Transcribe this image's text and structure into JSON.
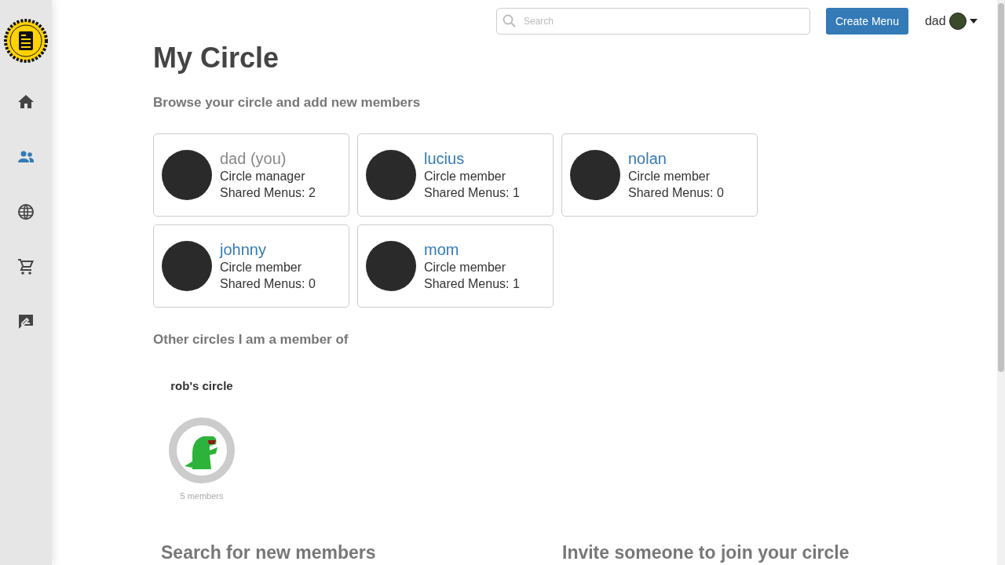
{
  "sidebar": {
    "items": [
      {
        "kind": "home",
        "selected": false
      },
      {
        "kind": "people",
        "selected": true
      },
      {
        "kind": "globe",
        "selected": false
      },
      {
        "kind": "cart",
        "selected": false
      },
      {
        "kind": "feedback",
        "selected": false
      }
    ]
  },
  "top_bar": {
    "search": {
      "placeholder": "Search"
    },
    "create_button": "Create Menu",
    "user": "dad"
  },
  "title": "My Circle",
  "subtitle": "Browse your circle and add new members",
  "members": [
    {
      "name": "dad (you)",
      "self": true,
      "role": "Circle manager",
      "shared": "Shared Menus: 2"
    },
    {
      "name": "lucius",
      "self": false,
      "role": "Circle member",
      "shared": "Shared Menus: 1"
    },
    {
      "name": "nolan",
      "self": false,
      "role": "Circle member",
      "shared": "Shared Menus: 0"
    },
    {
      "name": "johnny",
      "self": false,
      "role": "Circle member",
      "shared": "Shared Menus: 0"
    },
    {
      "name": "mom",
      "self": false,
      "role": "Circle member",
      "shared": "Shared Menus: 1"
    }
  ],
  "other_circles": {
    "heading": "Other circles I am a member of",
    "circles": [
      {
        "name": "rob's circle",
        "members": "5 members"
      }
    ]
  },
  "search_section": {
    "heading": "Search for new members"
  },
  "invite_section": {
    "heading": "Invite someone to join your circle"
  }
}
